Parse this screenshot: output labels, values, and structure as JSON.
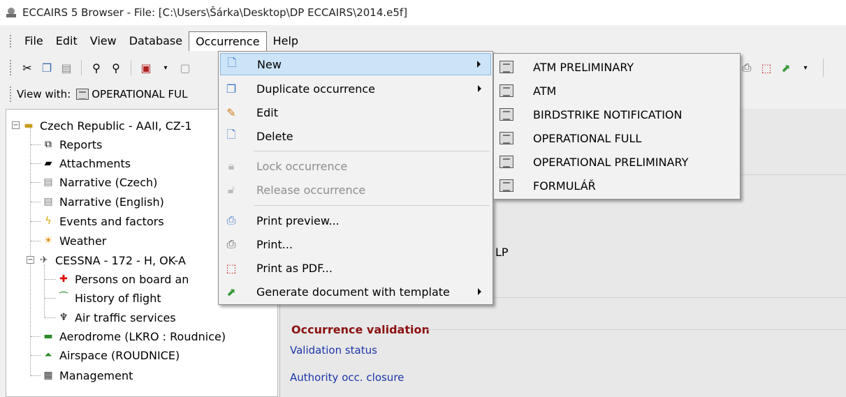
{
  "window": {
    "title": "ECCAIRS 5 Browser - File: [C:\\Users\\Šárka\\Desktop\\DP ECCAIRS\\2014.e5f]"
  },
  "menubar": {
    "items": [
      "File",
      "Edit",
      "View",
      "Database",
      "Occurrence",
      "Help"
    ],
    "active": "Occurrence"
  },
  "viewbar": {
    "label": "View with:",
    "value": "OPERATIONAL FUL"
  },
  "tree": {
    "root": "Czech Republic - AAII, CZ-1",
    "items": [
      "Reports",
      "Attachments",
      "Narrative (Czech)",
      "Narrative (English)",
      "Events and factors",
      "Weather",
      "CESSNA - 172 - H, OK-A",
      "Persons on board an",
      "History of flight",
      "Air traffic services",
      "Aerodrome (LKRO : Roudnice)",
      "Airspace (ROUDNICE)",
      "Management"
    ]
  },
  "occurrence_menu": {
    "items": [
      {
        "label": "New",
        "icon": "new-occurrence-icon",
        "submenu": true,
        "disabled": false,
        "highlighted": true
      },
      {
        "label": "Duplicate occurrence",
        "icon": "duplicate-icon",
        "submenu": true,
        "disabled": false
      },
      {
        "label": "Edit",
        "icon": "edit-icon",
        "submenu": false,
        "disabled": false
      },
      {
        "label": "Delete",
        "icon": "delete-icon",
        "submenu": false,
        "disabled": false
      },
      {
        "label": "Lock occurrence",
        "icon": "lock-icon",
        "submenu": false,
        "disabled": true
      },
      {
        "label": "Release occurrence",
        "icon": "unlock-icon",
        "submenu": false,
        "disabled": true
      },
      {
        "label": "Print preview...",
        "icon": "print-preview-icon",
        "submenu": false,
        "disabled": false
      },
      {
        "label": "Print...",
        "icon": "printer-icon",
        "submenu": false,
        "disabled": false
      },
      {
        "label": "Print as PDF...",
        "icon": "pdf-icon",
        "submenu": false,
        "disabled": false
      },
      {
        "label": "Generate document with template",
        "icon": "template-icon",
        "submenu": true,
        "disabled": false
      }
    ]
  },
  "new_submenu": {
    "items": [
      "ATM PRELIMINARY",
      "ATM",
      "BIRDSTRIKE NOTIFICATION",
      "OPERATIONAL FULL",
      "OPERATIONAL PRELIMINARY",
      "FORMULÁŘ"
    ]
  },
  "content": {
    "fragment": "LP",
    "section_title": "Occurrence validation",
    "links": [
      "Validation status",
      "Authority occ. closure"
    ]
  },
  "colors": {
    "menu_highlight": "#cce4f7",
    "section_title": "#8b1010",
    "link": "#1a36a8"
  }
}
